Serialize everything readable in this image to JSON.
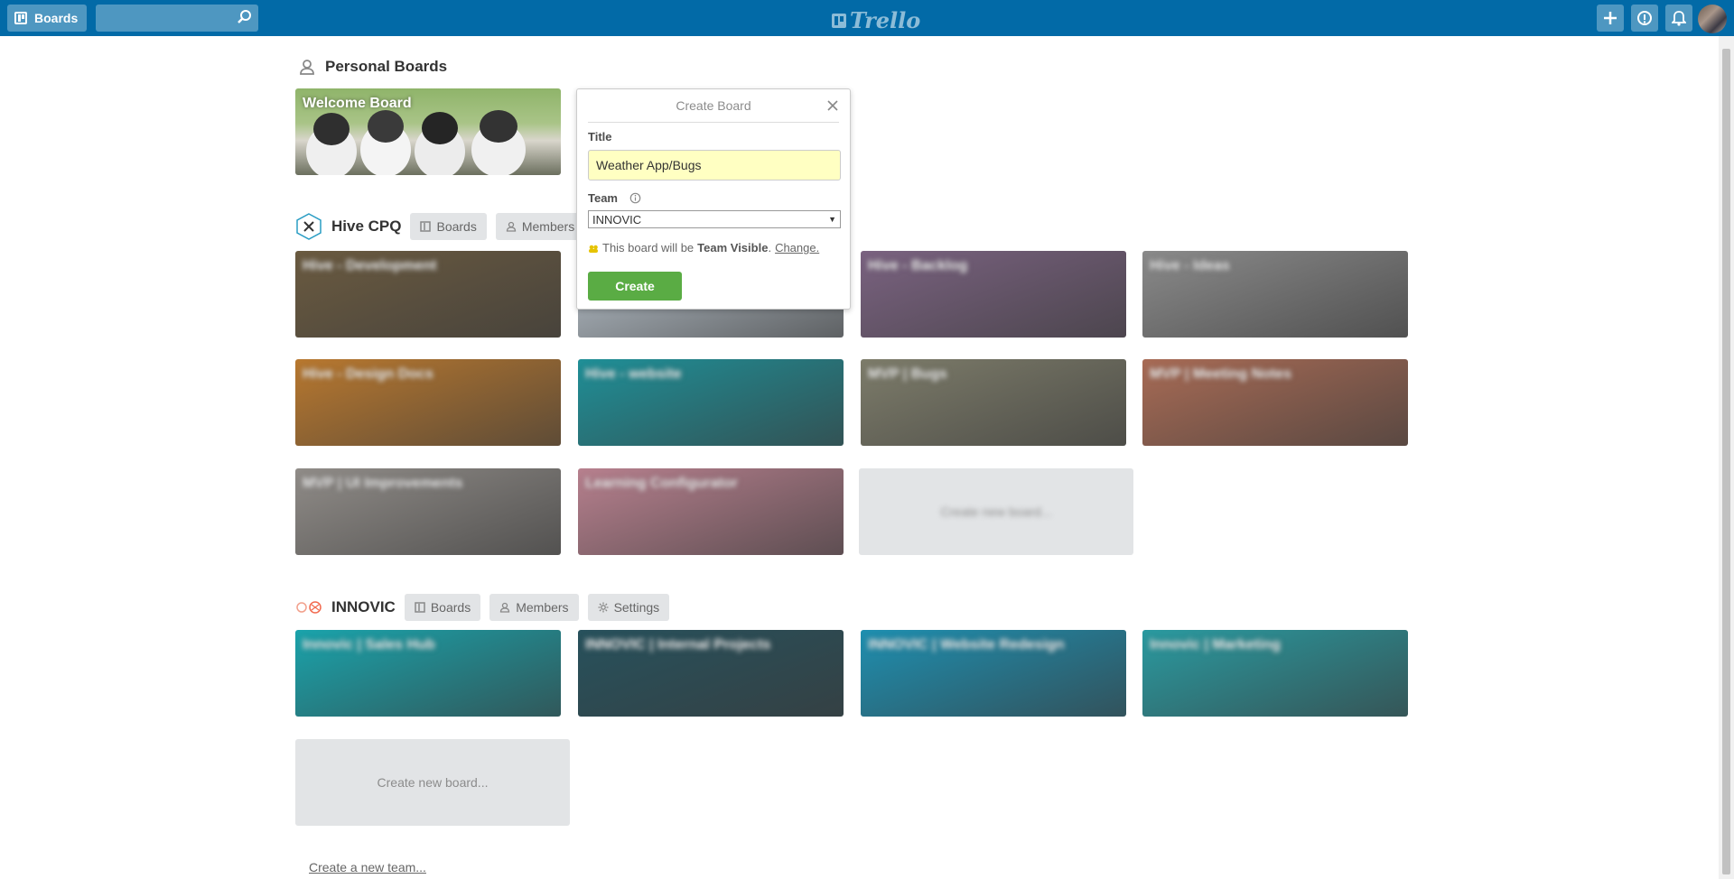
{
  "header": {
    "boards_label": "Boards",
    "logo_text": "Trello",
    "search_placeholder": ""
  },
  "personal": {
    "title": "Personal Boards",
    "boards": [
      {
        "name": "Welcome Board"
      }
    ]
  },
  "hive": {
    "title": "Hive CPQ",
    "boards_label": "Boards",
    "members_label": "Members",
    "boards": [
      {
        "name": "Hive - Development",
        "color": "#6a5a40"
      },
      {
        "name": "",
        "color": "#b9c3cc"
      },
      {
        "name": "Hive - Backlog",
        "color": "#7a6280"
      },
      {
        "name": "Hive - Ideas",
        "color": "#8a8a8a"
      },
      {
        "name": "Hive - Design Docs",
        "color": "#b8782f"
      },
      {
        "name": "Hive - website",
        "color": "#1f8f97"
      },
      {
        "name": "MVP | Bugs",
        "color": "#7d7c6a"
      },
      {
        "name": "MVP | Meeting Notes",
        "color": "#a86b55"
      },
      {
        "name": "MVP | UI Improvements",
        "color": "#908c88"
      },
      {
        "name": "Learning Configurator",
        "color": "#b7808e"
      }
    ],
    "create_label": "Create new board..."
  },
  "innovic": {
    "title": "INNOVIC",
    "boards_label": "Boards",
    "members_label": "Members",
    "settings_label": "Settings",
    "boards": [
      {
        "name": "Innovic | Sales Hub",
        "color": "#1aa3ab"
      },
      {
        "name": "INNOVIC | Internal Projects",
        "color": "#27515c"
      },
      {
        "name": "INNOVIC | Website Redesign",
        "color": "#1e8fb0"
      },
      {
        "name": "Innovic | Marketing",
        "color": "#2a9aa0"
      }
    ],
    "create_label": "Create new board..."
  },
  "footer": {
    "create_team": "Create a new team..."
  },
  "popover": {
    "title": "Create Board",
    "title_label": "Title",
    "title_value": "Weather App/Bugs",
    "team_label": "Team",
    "team_value": "INNOVIC",
    "visibility_prefix": "This board will be",
    "visibility_value": "Team Visible",
    "visibility_suffix": ".",
    "change_label": "Change.",
    "create_label": "Create"
  },
  "colors": {
    "header": "#026aa7",
    "create": "#5aac44",
    "input_bg": "#ffffc2"
  }
}
